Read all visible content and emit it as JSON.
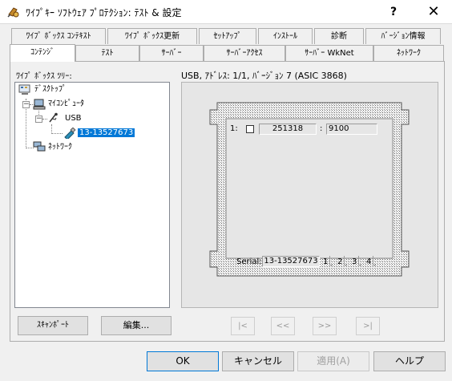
{
  "window": {
    "title": "ﾜｲﾌﾟｷｰ ｿﾌﾄｳｪｱ ﾌﾟﾛﾃｸｼｮﾝ: ﾃｽﾄ & 設定",
    "help_label": "?",
    "close_label": "✕"
  },
  "tabs": {
    "row1": [
      "ﾜｲﾌﾟ ﾎﾞｯｸｽ ｺﾝﾃｷｽﾄ",
      "ﾜｲﾌﾟ ﾎﾞｯｸｽ更新",
      "ｾｯﾄｱｯﾌﾟ",
      "ｲﾝｽﾄｰﾙ",
      "診断",
      "ﾊﾞｰｼﾞｮﾝ情報"
    ],
    "row2": [
      "ｺﾝﾃﾝｼﾞ",
      "ﾃｽﾄ",
      "ｻｰﾊﾞｰ",
      "ｻｰﾊﾞｰｱｸｾｽ",
      "ｻｰﾊﾞｰ WkNet",
      "ﾈｯﾄﾜｰｸ"
    ],
    "active": "ｺﾝﾃﾝｼﾞ"
  },
  "tree": {
    "label": "ﾜｲﾌﾟ ﾎﾞｯｸｽ ﾂﾘｰ:",
    "nodes": {
      "desktop": "ﾃﾞｽｸﾄｯﾌﾟ",
      "computer": "ﾏｲｺﾝﾋﾟｭｰﾀ",
      "usb": "USB",
      "device": "13-13527673",
      "network": "ﾈｯﾄﾜｰｸ"
    },
    "expander_minus": "−"
  },
  "device": {
    "header": "USB, ｱﾄﾞﾚｽ: 1/1, ﾊﾞｰｼﾞｮﾝ 7 (ASIC 3868)",
    "slot_index": "1:",
    "slot_value": "251318",
    "slot_sep": ":",
    "slot_code": "9100",
    "serial_label": "Serial:",
    "serial_value": "13-13527673",
    "ports": [
      "1",
      "2",
      "3",
      "4"
    ]
  },
  "buttons": {
    "scan": "ｽｷｬﾝﾎﾟｰﾄ",
    "edit": "編集...",
    "nav_first": "|<",
    "nav_prev": "<<",
    "nav_next": ">>",
    "nav_last": ">|",
    "ok": "OK",
    "cancel": "キャンセル",
    "apply": "適用(A)",
    "help": "ヘルプ"
  },
  "colors": {
    "selection": "#0078d7",
    "dongle_hatch": "#6e6e6e"
  }
}
